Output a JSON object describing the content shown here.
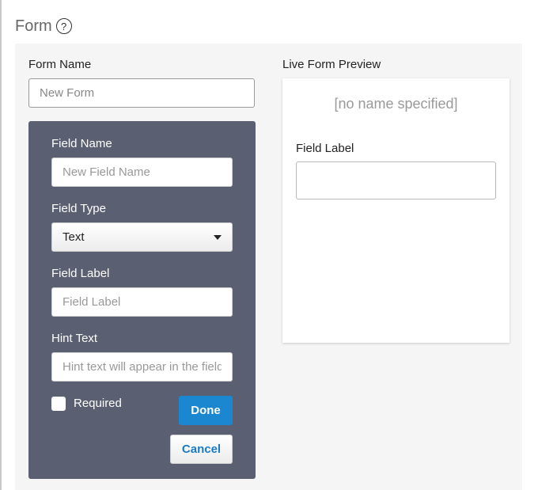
{
  "page": {
    "title": "Form",
    "help_icon": "question-mark-circle-icon",
    "help_glyph": "?"
  },
  "form": {
    "name_label": "Form Name",
    "name_placeholder": "New Form",
    "name_value": ""
  },
  "field_editor": {
    "field_name_label": "Field Name",
    "field_name_placeholder": "New Field Name",
    "field_type_label": "Field Type",
    "field_type_selected": "Text",
    "field_label_label": "Field Label",
    "field_label_placeholder": "Field Label",
    "hint_text_label": "Hint Text",
    "hint_text_placeholder": "Hint text will appear in the field",
    "required_label": "Required",
    "required_checked": false,
    "done_label": "Done",
    "cancel_label": "Cancel"
  },
  "preview": {
    "heading": "Live Form Preview",
    "form_name_display": "[no name specified]",
    "field_label": "Field Label"
  },
  "colors": {
    "editor_bg": "#5a6072",
    "primary_button": "#1a87d0",
    "link_text": "#1a7bc4",
    "panel_bg": "#f5f5f5"
  }
}
